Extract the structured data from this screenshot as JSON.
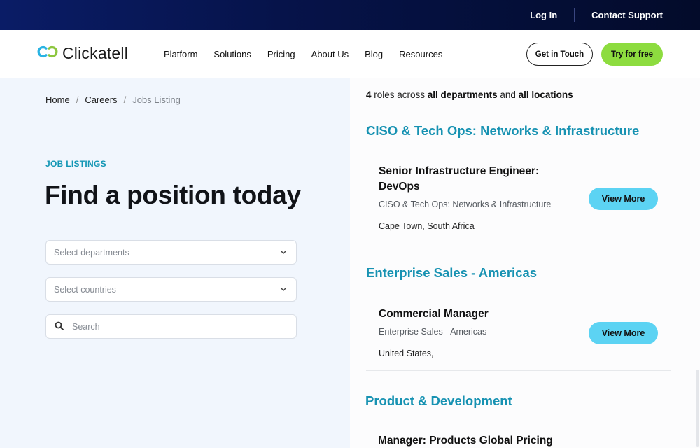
{
  "topbar": {
    "login_label": "Log In",
    "support_label": "Contact Support"
  },
  "navbar": {
    "logo_text": "Clickatell",
    "logo_icon": "linked-rings-icon",
    "links": [
      "Platform",
      "Solutions",
      "Pricing",
      "About Us",
      "Blog",
      "Resources"
    ],
    "get_in_touch_label": "Get in Touch",
    "try_free_label": "Try for free"
  },
  "colors": {
    "topbar": "#06134a",
    "accent_teal": "#1792b2",
    "cta_green": "#8ddc3f",
    "view_more_blue": "#5cd3f3",
    "hero_bg": "#f1f6fd",
    "logo_blue": "#29b3e3",
    "logo_green": "#8dc63f"
  },
  "breadcrumb": {
    "items": [
      "Home",
      "Careers"
    ],
    "separator": "/",
    "current": "Jobs Listing"
  },
  "hero": {
    "eyebrow": "JOB LISTINGS",
    "title": "Find a position today",
    "departments_placeholder": "Select departments",
    "countries_placeholder": "Select countries",
    "search_placeholder": "Search",
    "search_value": ""
  },
  "summary": {
    "count": "4",
    "text1": " roles across ",
    "departments": "all departments",
    "text2": " and ",
    "locations": "all locations"
  },
  "groups": [
    {
      "department": "CISO & Tech Ops: Networks & Infrastructure",
      "jobs": [
        {
          "title_line1": "Senior Infrastructure Engineer:",
          "title_line2": "DevOps",
          "department": "CISO & Tech Ops: Networks & Infrastructure",
          "location": "Cape Town, South Africa",
          "button": "View More"
        }
      ]
    },
    {
      "department": "Enterprise Sales - Americas",
      "jobs": [
        {
          "title_line1": "Commercial Manager",
          "department": "Enterprise Sales - Americas",
          "location": "United States,",
          "button": "View More"
        }
      ]
    },
    {
      "department": "Product & Development",
      "jobs": [
        {
          "title_line1": "Manager: Products Global Pricing"
        }
      ]
    }
  ]
}
